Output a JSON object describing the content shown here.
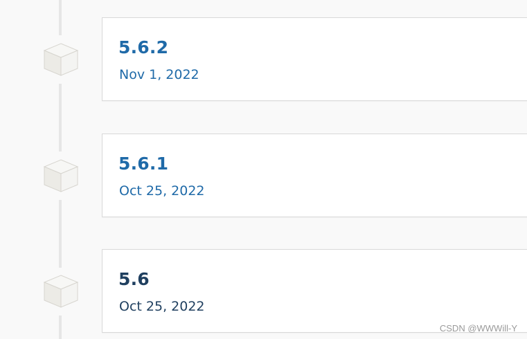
{
  "releases": [
    {
      "version": "5.6.2",
      "date": "Nov 1, 2022",
      "text_color": "#1f6aa8"
    },
    {
      "version": "5.6.1",
      "date": "Oct 25, 2022",
      "text_color": "#1f6aa8"
    },
    {
      "version": "5.6",
      "date": "Oct 25, 2022",
      "text_color": "#1f3f5f"
    }
  ],
  "watermark": "CSDN @WWWill-Y",
  "colors": {
    "timeline": "#e6e6e6",
    "card_border": "#d9d9d9",
    "page_background": "#f9f9f9",
    "icon_top": "#f7f7f5",
    "icon_left": "#ecebe6",
    "icon_right": "#f4f4f2",
    "icon_stroke": "#d7d5cf"
  },
  "icons": {
    "release": "release-box-icon"
  }
}
